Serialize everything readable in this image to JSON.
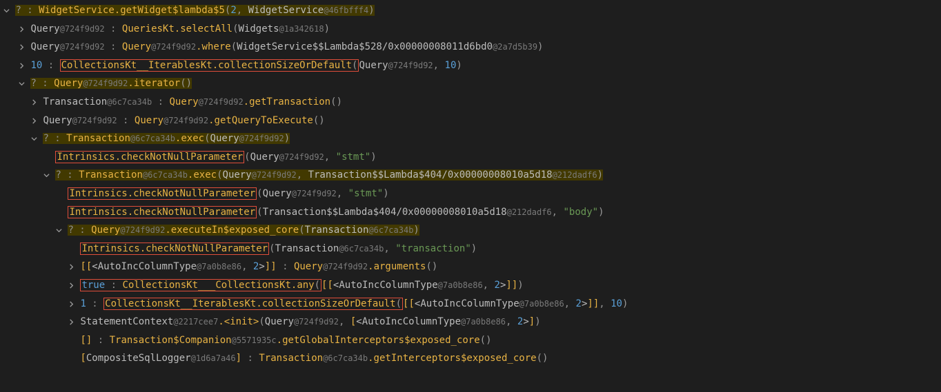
{
  "tokens": {
    "q": "?",
    "colon": " : ",
    "commaSp": ", ",
    "dot": ".",
    "lp": "(",
    "rp": ")",
    "lb": "[",
    "rb": "]",
    "ldb": "[[",
    "rdb": "]]",
    "lt": "<",
    "gt": ">",
    "ten": "10",
    "one": "1",
    "two": "2",
    "trueLit": "true",
    "emptyArr": "[]"
  },
  "obj": {
    "WidgetService": "WidgetService",
    "Query": "Query",
    "Widgets": "Widgets",
    "Transaction": "Transaction",
    "TransactionCompanion": "Transaction$Companion",
    "AutoIncColumnType": "AutoIncColumnType",
    "StatementContext": "StatementContext",
    "CompositeSqlLogger": "CompositeSqlLogger",
    "WSLambda528": "WidgetService$$Lambda$528/0x00000008011d6bd0",
    "TxnLambda404": "Transaction$$Lambda$404/0x00000008010a5d18"
  },
  "hash": {
    "WidgetService": "@46fbfff4",
    "Query": "@724f9d92",
    "Widgets": "@1a342618",
    "Transaction": "@6c7ca34b",
    "WSLambda528": "@2a7d5b39",
    "TxnLambda404": "@212dadf6",
    "AutoIncColumnType": "@7a0b8e86",
    "StatementContext": "@2217cee7",
    "TransactionCompanion": "@5571935c",
    "CompositeSqlLogger": "@1d6a7a46"
  },
  "method": {
    "getWidgetLambda5": "getWidget$lambda$5",
    "selectAll": "selectAll",
    "where": "where",
    "collectionSizeOrDefault": "CollectionsKt__IterablesKt.collectionSizeOrDefault",
    "iterator": "iterator",
    "getTransaction": "getTransaction",
    "getQueryToExecute": "getQueryToExecute",
    "exec": "exec",
    "checkNotNullParameter": "Intrinsics.checkNotNullParameter",
    "executeIn": "executeIn$exposed_core",
    "arguments": "arguments",
    "any": "CollectionsKt___CollectionsKt.any",
    "init": "<init>",
    "getGlobalInterceptors": "getGlobalInterceptors$exposed_core",
    "getInterceptors": "getInterceptors$exposed_core",
    "QueriesKt": "QueriesKt"
  },
  "str": {
    "stmt": "\"stmt\"",
    "body": "\"body\"",
    "transaction": "\"transaction\""
  }
}
